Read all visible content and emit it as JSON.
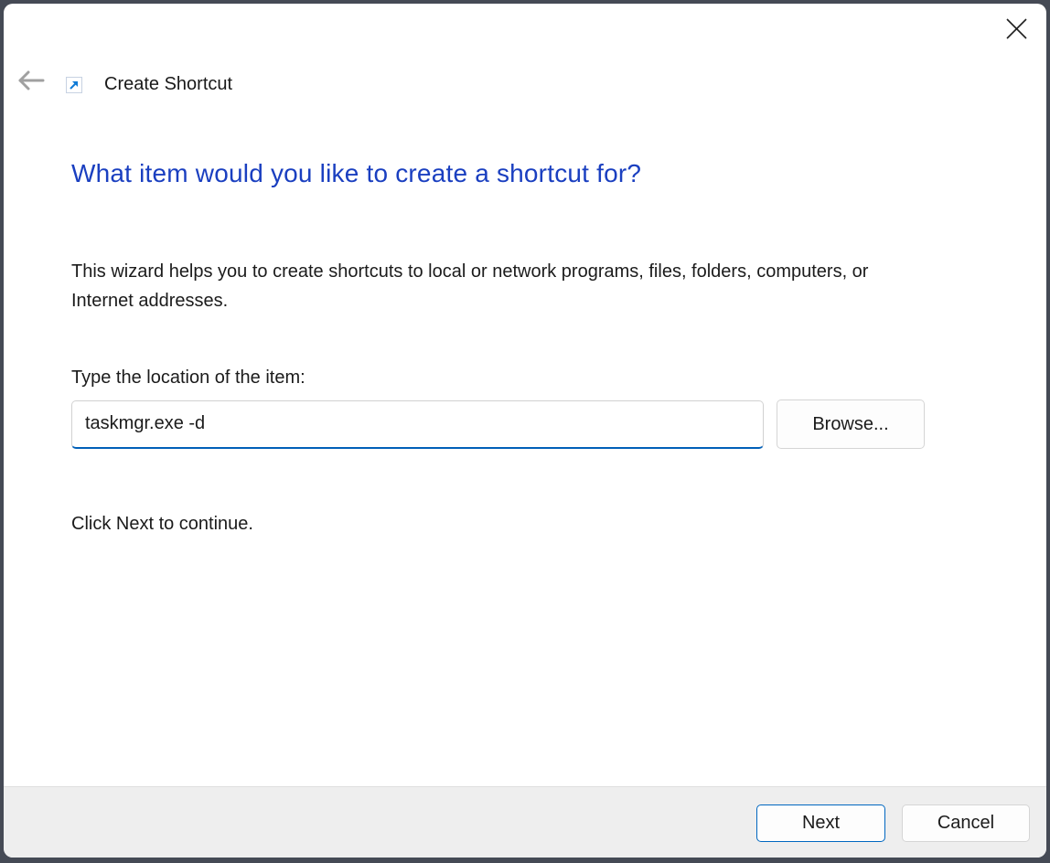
{
  "titlebar": {
    "title": "Create Shortcut",
    "back_icon": "arrow-left",
    "app_icon": "shortcut-arrow-up-right",
    "close_icon": "x"
  },
  "wizard": {
    "heading": "What item would you like to create a shortcut for?",
    "description": "This wizard helps you to create shortcuts to local or network programs, files, folders, computers, or Internet addresses.",
    "location_label": "Type the location of the item:",
    "location_value": "taskmgr.exe -d",
    "browse_label": "Browse...",
    "hint": "Click Next to continue."
  },
  "footer": {
    "next_label": "Next",
    "cancel_label": "Cancel"
  },
  "colors": {
    "heading_blue": "#1a3fc0",
    "input_focus_underline": "#005fb8",
    "next_button_border": "#0067c0",
    "window_frame": "#454a55",
    "footer_background": "#eeeeee",
    "shortcut_arrow_blue": "#0f7bd7",
    "back_arrow_gray": "#a0a0a0"
  }
}
